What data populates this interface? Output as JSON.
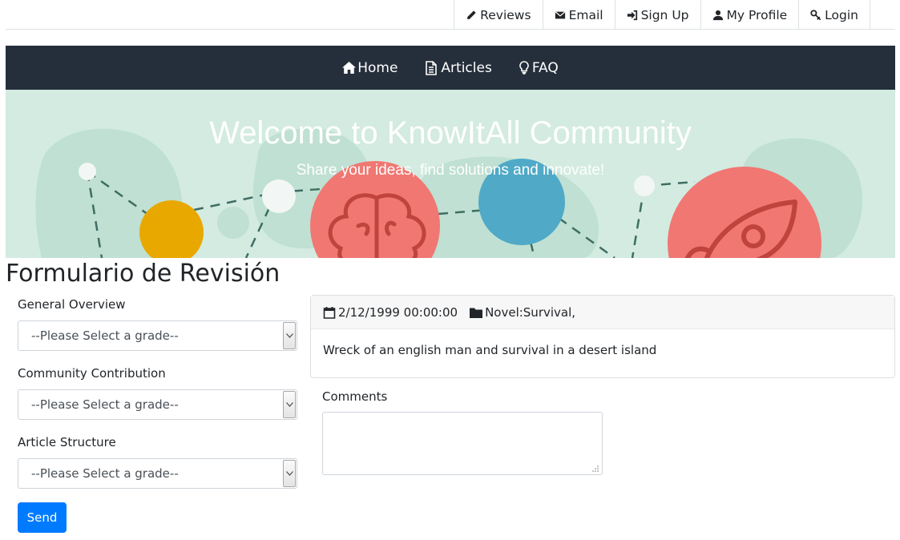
{
  "topnav": {
    "items": [
      {
        "label": "Reviews",
        "icon": "pencil-icon"
      },
      {
        "label": "Email",
        "icon": "envelope-icon"
      },
      {
        "label": "Sign Up",
        "icon": "sign-in-icon"
      },
      {
        "label": "My Profile",
        "icon": "user-icon"
      },
      {
        "label": "Login",
        "icon": "key-icon"
      }
    ]
  },
  "mainnav": {
    "items": [
      {
        "label": "Home",
        "icon": "home-icon"
      },
      {
        "label": "Articles",
        "icon": "file-text-icon"
      },
      {
        "label": "FAQ",
        "icon": "lightbulb-icon"
      }
    ],
    "background": "#252f3b"
  },
  "hero": {
    "title": "Welcome to KnowItAll Community",
    "subtitle": "Share your ideas, find solutions and innovate!",
    "colors": {
      "background": "#d3ebe1",
      "yellow": "#e8a800",
      "coral": "#f07772",
      "blue": "#4fa9c7"
    }
  },
  "page": {
    "title": "Formulario de Revisión"
  },
  "form": {
    "fields": [
      {
        "label": "General Overview",
        "selected": "--Please Select a grade--"
      },
      {
        "label": "Community Contribution",
        "selected": "--Please Select a grade--"
      },
      {
        "label": "Article Structure",
        "selected": "--Please Select a grade--"
      }
    ],
    "send_label": "Send",
    "send_color": "#007bff"
  },
  "article": {
    "date": "2/12/1999 00:00:00",
    "category": "Novel:Survival,",
    "description": "Wreck of an english man and survival in a desert island"
  },
  "comments": {
    "label": "Comments",
    "value": ""
  }
}
